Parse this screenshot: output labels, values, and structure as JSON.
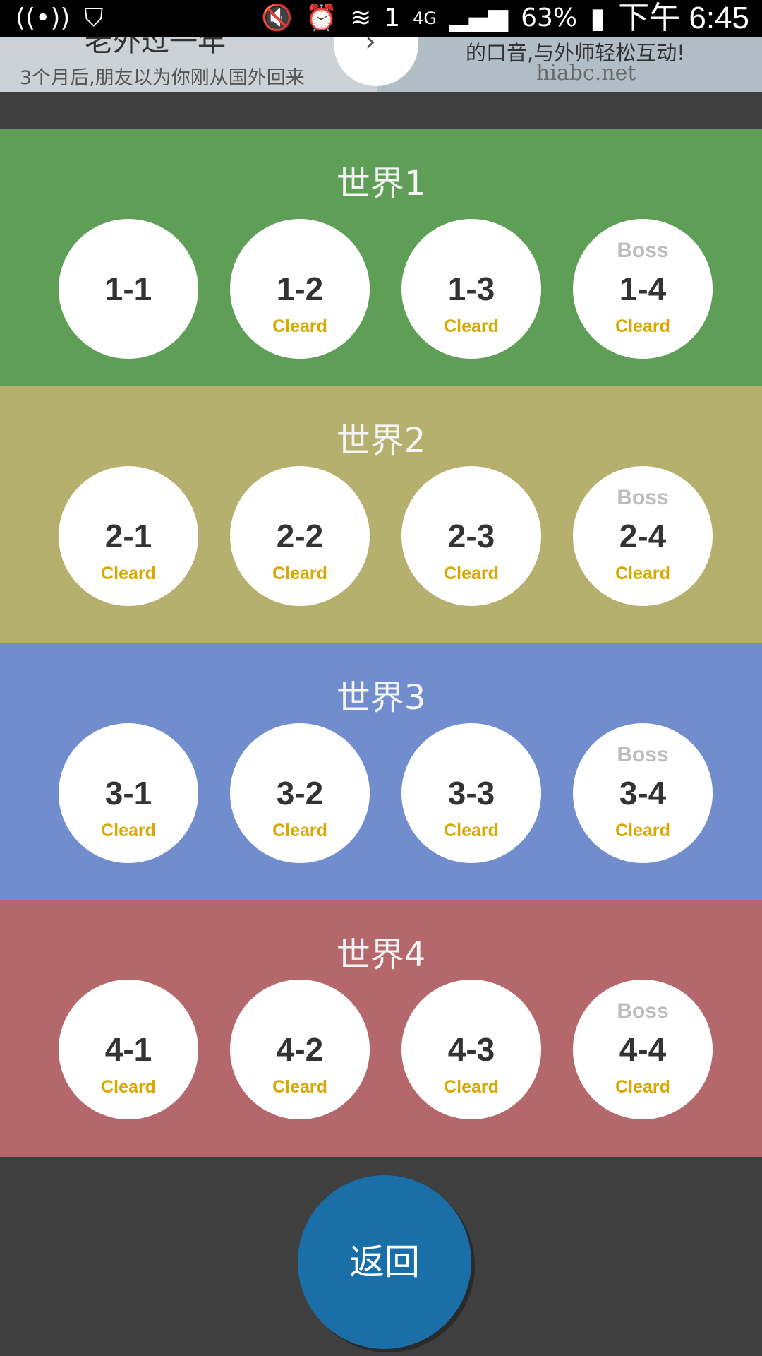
{
  "status_bar": {
    "left_icons": [
      "broadcast-icon",
      "shield-check-icon"
    ],
    "right_icons": [
      "mute-icon",
      "alarm-icon",
      "wifi-icon",
      "sim-1-icon",
      "network-4g-icon",
      "signal-icon"
    ],
    "sim_label": "1",
    "network_label": "4G",
    "battery": "63%",
    "time": "下午 6:45"
  },
  "ad": {
    "left_title": "老外过一年",
    "left_subtitle": "3个月后,朋友以为你刚从国外回来",
    "arrow_icon": "chevron-right-icon",
    "right_line1": "的口音,与外师轻松互动!",
    "right_line2": "hiabc.net"
  },
  "worlds": [
    {
      "title": "世界1",
      "color": "#5f9e57",
      "levels": [
        {
          "boss": "",
          "code": "1-1",
          "status": ""
        },
        {
          "boss": "",
          "code": "1-2",
          "status": "Cleard"
        },
        {
          "boss": "",
          "code": "1-3",
          "status": "Cleard"
        },
        {
          "boss": "Boss",
          "code": "1-4",
          "status": "Cleard"
        }
      ]
    },
    {
      "title": "世界2",
      "color": "#b6b06e",
      "levels": [
        {
          "boss": "",
          "code": "2-1",
          "status": "Cleard"
        },
        {
          "boss": "",
          "code": "2-2",
          "status": "Cleard"
        },
        {
          "boss": "",
          "code": "2-3",
          "status": "Cleard"
        },
        {
          "boss": "Boss",
          "code": "2-4",
          "status": "Cleard"
        }
      ]
    },
    {
      "title": "世界3",
      "color": "#728dcd",
      "levels": [
        {
          "boss": "",
          "code": "3-1",
          "status": "Cleard"
        },
        {
          "boss": "",
          "code": "3-2",
          "status": "Cleard"
        },
        {
          "boss": "",
          "code": "3-3",
          "status": "Cleard"
        },
        {
          "boss": "Boss",
          "code": "3-4",
          "status": "Cleard"
        }
      ]
    },
    {
      "title": "世界4",
      "color": "#b5686b",
      "levels": [
        {
          "boss": "",
          "code": "4-1",
          "status": "Cleard"
        },
        {
          "boss": "",
          "code": "4-2",
          "status": "Cleard"
        },
        {
          "boss": "",
          "code": "4-3",
          "status": "Cleard"
        },
        {
          "boss": "Boss",
          "code": "4-4",
          "status": "Cleard"
        }
      ]
    }
  ],
  "back_button": {
    "label": "返回",
    "color": "#1b6fa8"
  }
}
